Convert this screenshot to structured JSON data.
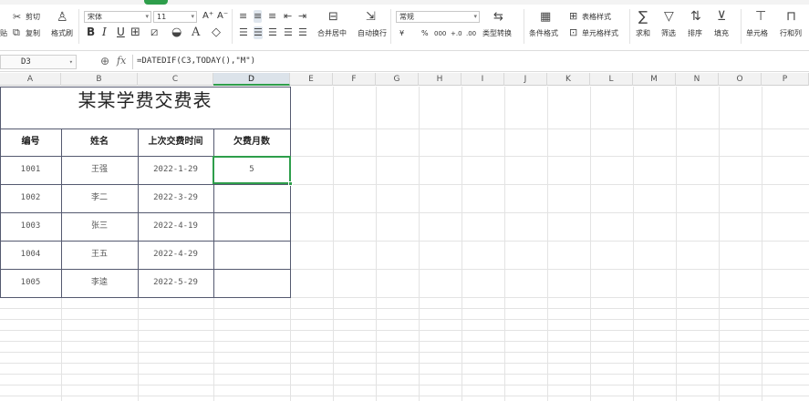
{
  "ribbon": {
    "clipboard": {
      "cut": "剪切",
      "copy": "复制",
      "format_painter": "格式刷",
      "paste_partial": "贴"
    },
    "font": {
      "name": "宋体",
      "size": "11",
      "grow": "A⁺",
      "shrink": "A⁻",
      "bold": "B",
      "italic": "I",
      "underline": "U"
    },
    "alignment": {
      "merge_center": "合并居中",
      "wrap_text": "自动换行"
    },
    "number": {
      "format": "常规",
      "currency": "¥",
      "percent": "%",
      "thousands": "000",
      "inc_decimal": "+.0",
      "dec_decimal": ".00",
      "convert_type": "类型转换"
    },
    "styles": {
      "conditional_format": "条件格式",
      "table_style": "表格样式",
      "cell_style": "单元格样式"
    },
    "editing": {
      "sum": "求和",
      "filter": "筛选",
      "sort": "排序",
      "fill": "填充",
      "cells": "单元格",
      "rows_cols": "行和列"
    }
  },
  "formula_bar": {
    "name_box": "D3",
    "fx": "fx",
    "formula": "=DATEDIF(C3,TODAY(),\"M\")"
  },
  "columns": [
    "A",
    "B",
    "C",
    "D",
    "E",
    "F",
    "G",
    "H",
    "I",
    "J",
    "K",
    "L",
    "M",
    "N",
    "O",
    "P"
  ],
  "selected_column": "D",
  "sheet": {
    "title": "某某学费交费表",
    "headers": [
      "编号",
      "姓名",
      "上次交费时间",
      "欠费月数"
    ],
    "rows": [
      {
        "id": "1001",
        "name": "王强",
        "date": "2022-1-29",
        "months": "5"
      },
      {
        "id": "1002",
        "name": "李二",
        "date": "2022-3-29",
        "months": ""
      },
      {
        "id": "1003",
        "name": "张三",
        "date": "2022-4-19",
        "months": ""
      },
      {
        "id": "1004",
        "name": "王五",
        "date": "2022-4-29",
        "months": ""
      },
      {
        "id": "1005",
        "name": "李逵",
        "date": "2022-5-29",
        "months": ""
      }
    ]
  },
  "colors": {
    "accent": "#2e9e4b",
    "table_border": "#555a70",
    "selected_header": "#dce3ea"
  }
}
